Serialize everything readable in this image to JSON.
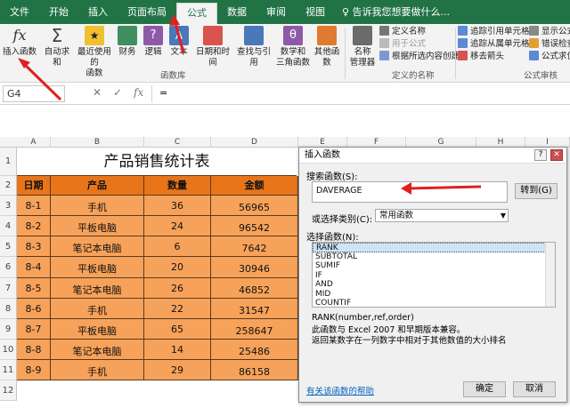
{
  "tabs": [
    "文件",
    "开始",
    "插入",
    "页面布局",
    "公式",
    "数据",
    "审阅",
    "视图"
  ],
  "active_tab": "公式",
  "tell_me": "♀ 告诉我您想要做什么...",
  "ribbon": {
    "insert_fn": "插入函数",
    "autosum": "自动求和",
    "recent": "最近使用的",
    "recent2": "函数",
    "finance": "财务",
    "logic": "逻辑",
    "text": "文本",
    "datetime": "日期和时间",
    "lookup": "查找与引用",
    "math": "数学和",
    "math2": "三角函数",
    "other": "其他函数",
    "lib_label": "函数库",
    "name_mgr": "名称",
    "name_mgr2": "管理器",
    "define_name": "定义名称",
    "use_in_formula": "用于公式",
    "create_from_sel": "根据所选内容创建",
    "defined_names_label": "定义的名称",
    "trace_prec": "追踪引用单元格",
    "trace_dep": "追踪从属单元格",
    "remove_arrows": "移去箭头",
    "show_formulas": "显示公式",
    "error_check": "错误检查",
    "eval_formula": "公式求值",
    "audit_label": "公式审核"
  },
  "formula_bar": {
    "name_box": "G4",
    "cancel": "✕",
    "enter": "✓",
    "fx": "fx",
    "content": "="
  },
  "columns": [
    "A",
    "B",
    "C",
    "D",
    "E",
    "F",
    "G",
    "H",
    "I"
  ],
  "rows": [
    "1",
    "2",
    "3",
    "4",
    "5",
    "6",
    "7",
    "8",
    "9",
    "10",
    "11",
    "12"
  ],
  "table": {
    "title": "产品销售统计表",
    "headers": [
      "日期",
      "产品",
      "数量",
      "金额"
    ],
    "rows": [
      [
        "8-1",
        "手机",
        "36",
        "56965"
      ],
      [
        "8-2",
        "平板电脑",
        "24",
        "96542"
      ],
      [
        "8-3",
        "笔记本电脑",
        "6",
        "7642"
      ],
      [
        "8-4",
        "平板电脑",
        "20",
        "30946"
      ],
      [
        "8-5",
        "笔记本电脑",
        "26",
        "46852"
      ],
      [
        "8-6",
        "手机",
        "22",
        "31547"
      ],
      [
        "8-7",
        "平板电脑",
        "65",
        "258647"
      ],
      [
        "8-8",
        "笔记本电脑",
        "14",
        "25486"
      ],
      [
        "8-9",
        "手机",
        "29",
        "86158"
      ]
    ]
  },
  "dialog": {
    "title": "插入函数",
    "help_btn": "?",
    "close_btn": "✕",
    "search_label": "搜索函数(S):",
    "search_value": "DAVERAGE",
    "goto_btn": "转到(G)",
    "category_label": "或选择类别(C):",
    "category_value": "常用函数",
    "select_label": "选择函数(N):",
    "functions": [
      "RANK",
      "SUBTOTAL",
      "SUMIF",
      "IF",
      "AND",
      "MID",
      "COUNTIF"
    ],
    "selected_function": "RANK",
    "signature": "RANK(number,ref,order)",
    "desc1": "此函数与 Excel 2007 和早期版本兼容。",
    "desc2": "返回某数字在一列数字中相对于其他数值的大小排名",
    "help_link": "有关该函数的帮助",
    "ok_btn": "确定",
    "cancel_btn": "取消"
  },
  "colors": {
    "excel_green": "#217346",
    "table_fill": "#f7a25a",
    "header_fill": "#e8751a",
    "arrow_red": "#e02020"
  }
}
